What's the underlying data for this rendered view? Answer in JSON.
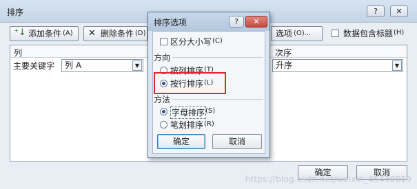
{
  "outer": {
    "title": "排序",
    "help_label": "?",
    "close_label": "✕",
    "toolbar": {
      "add_condition": "添加条件",
      "add_condition_key": "(A)",
      "delete_condition": "删除条件",
      "delete_condition_key": "(D)",
      "options": "选项",
      "options_key": "(O)...",
      "header_checkbox_label": "数据包含标题",
      "header_checkbox_key": "(H)"
    },
    "columns": {
      "column_header": "列",
      "order_header": "次序"
    },
    "row": {
      "label": "主要关键字",
      "column_value": "列 A",
      "order_value": "升序"
    },
    "ok": "确定",
    "cancel": "取消"
  },
  "inner": {
    "title": "排序选项",
    "help_label": "?",
    "close_label": "✕",
    "case_sensitive": "区分大小写",
    "case_sensitive_key": "(C)",
    "orientation_header": "方向",
    "sort_top_to_bottom": "按列排序",
    "sort_top_to_bottom_key": "(T)",
    "sort_left_to_right": "按行排序",
    "sort_left_to_right_key": "(L)",
    "method_header": "方法",
    "letter_sort": "字母排序",
    "letter_sort_key": "(S)",
    "stroke_sort": "笔划排序",
    "stroke_sort_key": "(R)",
    "ok": "确定",
    "cancel": "取消",
    "selected_orientation": "按行排序",
    "selected_method": "字母排序"
  },
  "watermark": "https://blog.csdn.net/weixin_45430019",
  "colors": {
    "highlight": "#e0262c",
    "close_button": "#c9463d"
  }
}
